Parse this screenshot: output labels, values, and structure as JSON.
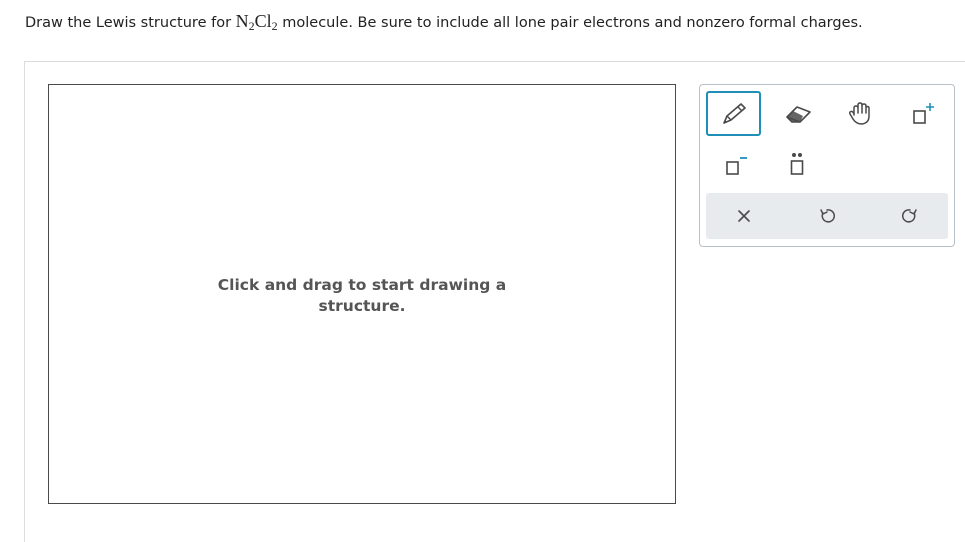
{
  "question": {
    "prefix": "Draw the Lewis structure for ",
    "formula_n": "N",
    "formula_n_sub": "2",
    "formula_cl": "Cl",
    "formula_cl_sub": "2",
    "suffix": " molecule. Be sure to include all lone pair electrons and nonzero formal charges."
  },
  "canvas": {
    "hint_line1": "Click and drag to start drawing a",
    "hint_line2": "structure."
  },
  "toolbar": {
    "tools": [
      {
        "name": "pencil-icon",
        "selected": true
      },
      {
        "name": "eraser-icon",
        "selected": false
      },
      {
        "name": "hand-icon",
        "selected": false
      },
      {
        "name": "add-charge-icon",
        "selected": false
      },
      {
        "name": "negative-charge-icon",
        "selected": false
      },
      {
        "name": "lone-pair-icon",
        "selected": false
      }
    ],
    "actions": [
      "close-icon",
      "undo-icon",
      "redo-icon"
    ]
  },
  "colors": {
    "accent": "#1f8fb8",
    "icon": "#4a4a4a",
    "actionbar": "#e8ebee"
  }
}
